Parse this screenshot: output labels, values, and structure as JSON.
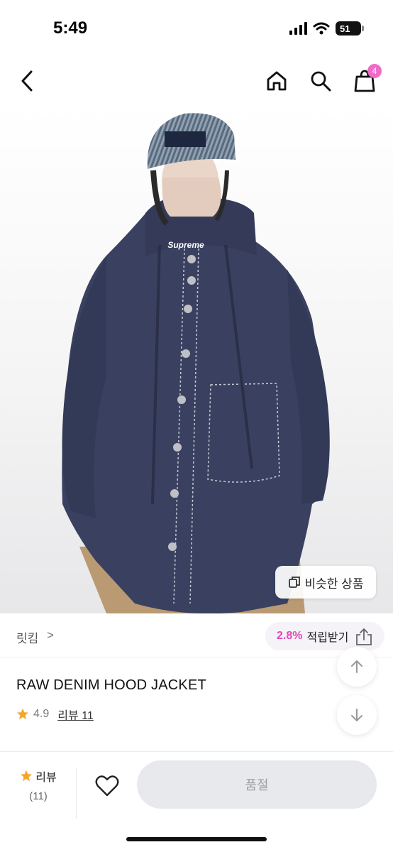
{
  "status_bar": {
    "time": "5:49",
    "battery": "51"
  },
  "nav": {
    "cart_count": "4"
  },
  "product": {
    "similar_label": "비슷한 상품",
    "brand": "릿킴",
    "brand_chevron": ">",
    "points_rate": "2.8%",
    "points_label": "적립받기",
    "title": "RAW DENIM HOOD JACKET",
    "rating": "4.9",
    "review_link": "리뷰 11",
    "cap_logo": "Supreme"
  },
  "bottom_bar": {
    "review_label": "리뷰",
    "review_count": "(11)",
    "soldout_label": "품절"
  },
  "colors": {
    "accent_pink": "#e049b9",
    "badge_pink": "#f06ac8",
    "star": "#f4a62a",
    "soldout_bg": "#e8e9ec"
  },
  "icons": [
    "back-icon",
    "home-icon",
    "search-icon",
    "bag-icon",
    "copy-icon",
    "share-icon",
    "star-icon",
    "arrow-up-icon",
    "arrow-down-icon",
    "heart-icon"
  ]
}
